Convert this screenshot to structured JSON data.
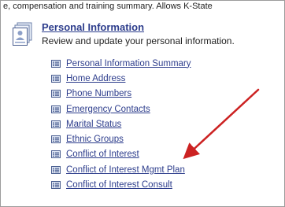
{
  "intro_text": "e, compensation and training summary. Allows K-State",
  "section": {
    "title": "Personal Information",
    "description": "Review and update your personal information.",
    "icon": "user-card-icon"
  },
  "links": [
    {
      "label": "Personal Information Summary",
      "name": "link-personal-information-summary"
    },
    {
      "label": "Home Address",
      "name": "link-home-address"
    },
    {
      "label": "Phone Numbers",
      "name": "link-phone-numbers"
    },
    {
      "label": "Emergency Contacts",
      "name": "link-emergency-contacts"
    },
    {
      "label": "Marital Status",
      "name": "link-marital-status"
    },
    {
      "label": "Ethnic Groups",
      "name": "link-ethnic-groups"
    },
    {
      "label": "Conflict of Interest",
      "name": "link-conflict-of-interest"
    },
    {
      "label": "Conflict of Interest Mgmt Plan",
      "name": "link-conflict-of-interest-mgmt-plan"
    },
    {
      "label": "Conflict of Interest Consult",
      "name": "link-conflict-of-interest-consult"
    }
  ],
  "link_icon": "list-page-icon",
  "annotation": {
    "type": "arrow",
    "color": "#cc2222",
    "points_to": "Conflict of Interest"
  },
  "colors": {
    "link": "#2d3d8c",
    "text": "#222222",
    "border": "#9b9b9b"
  }
}
